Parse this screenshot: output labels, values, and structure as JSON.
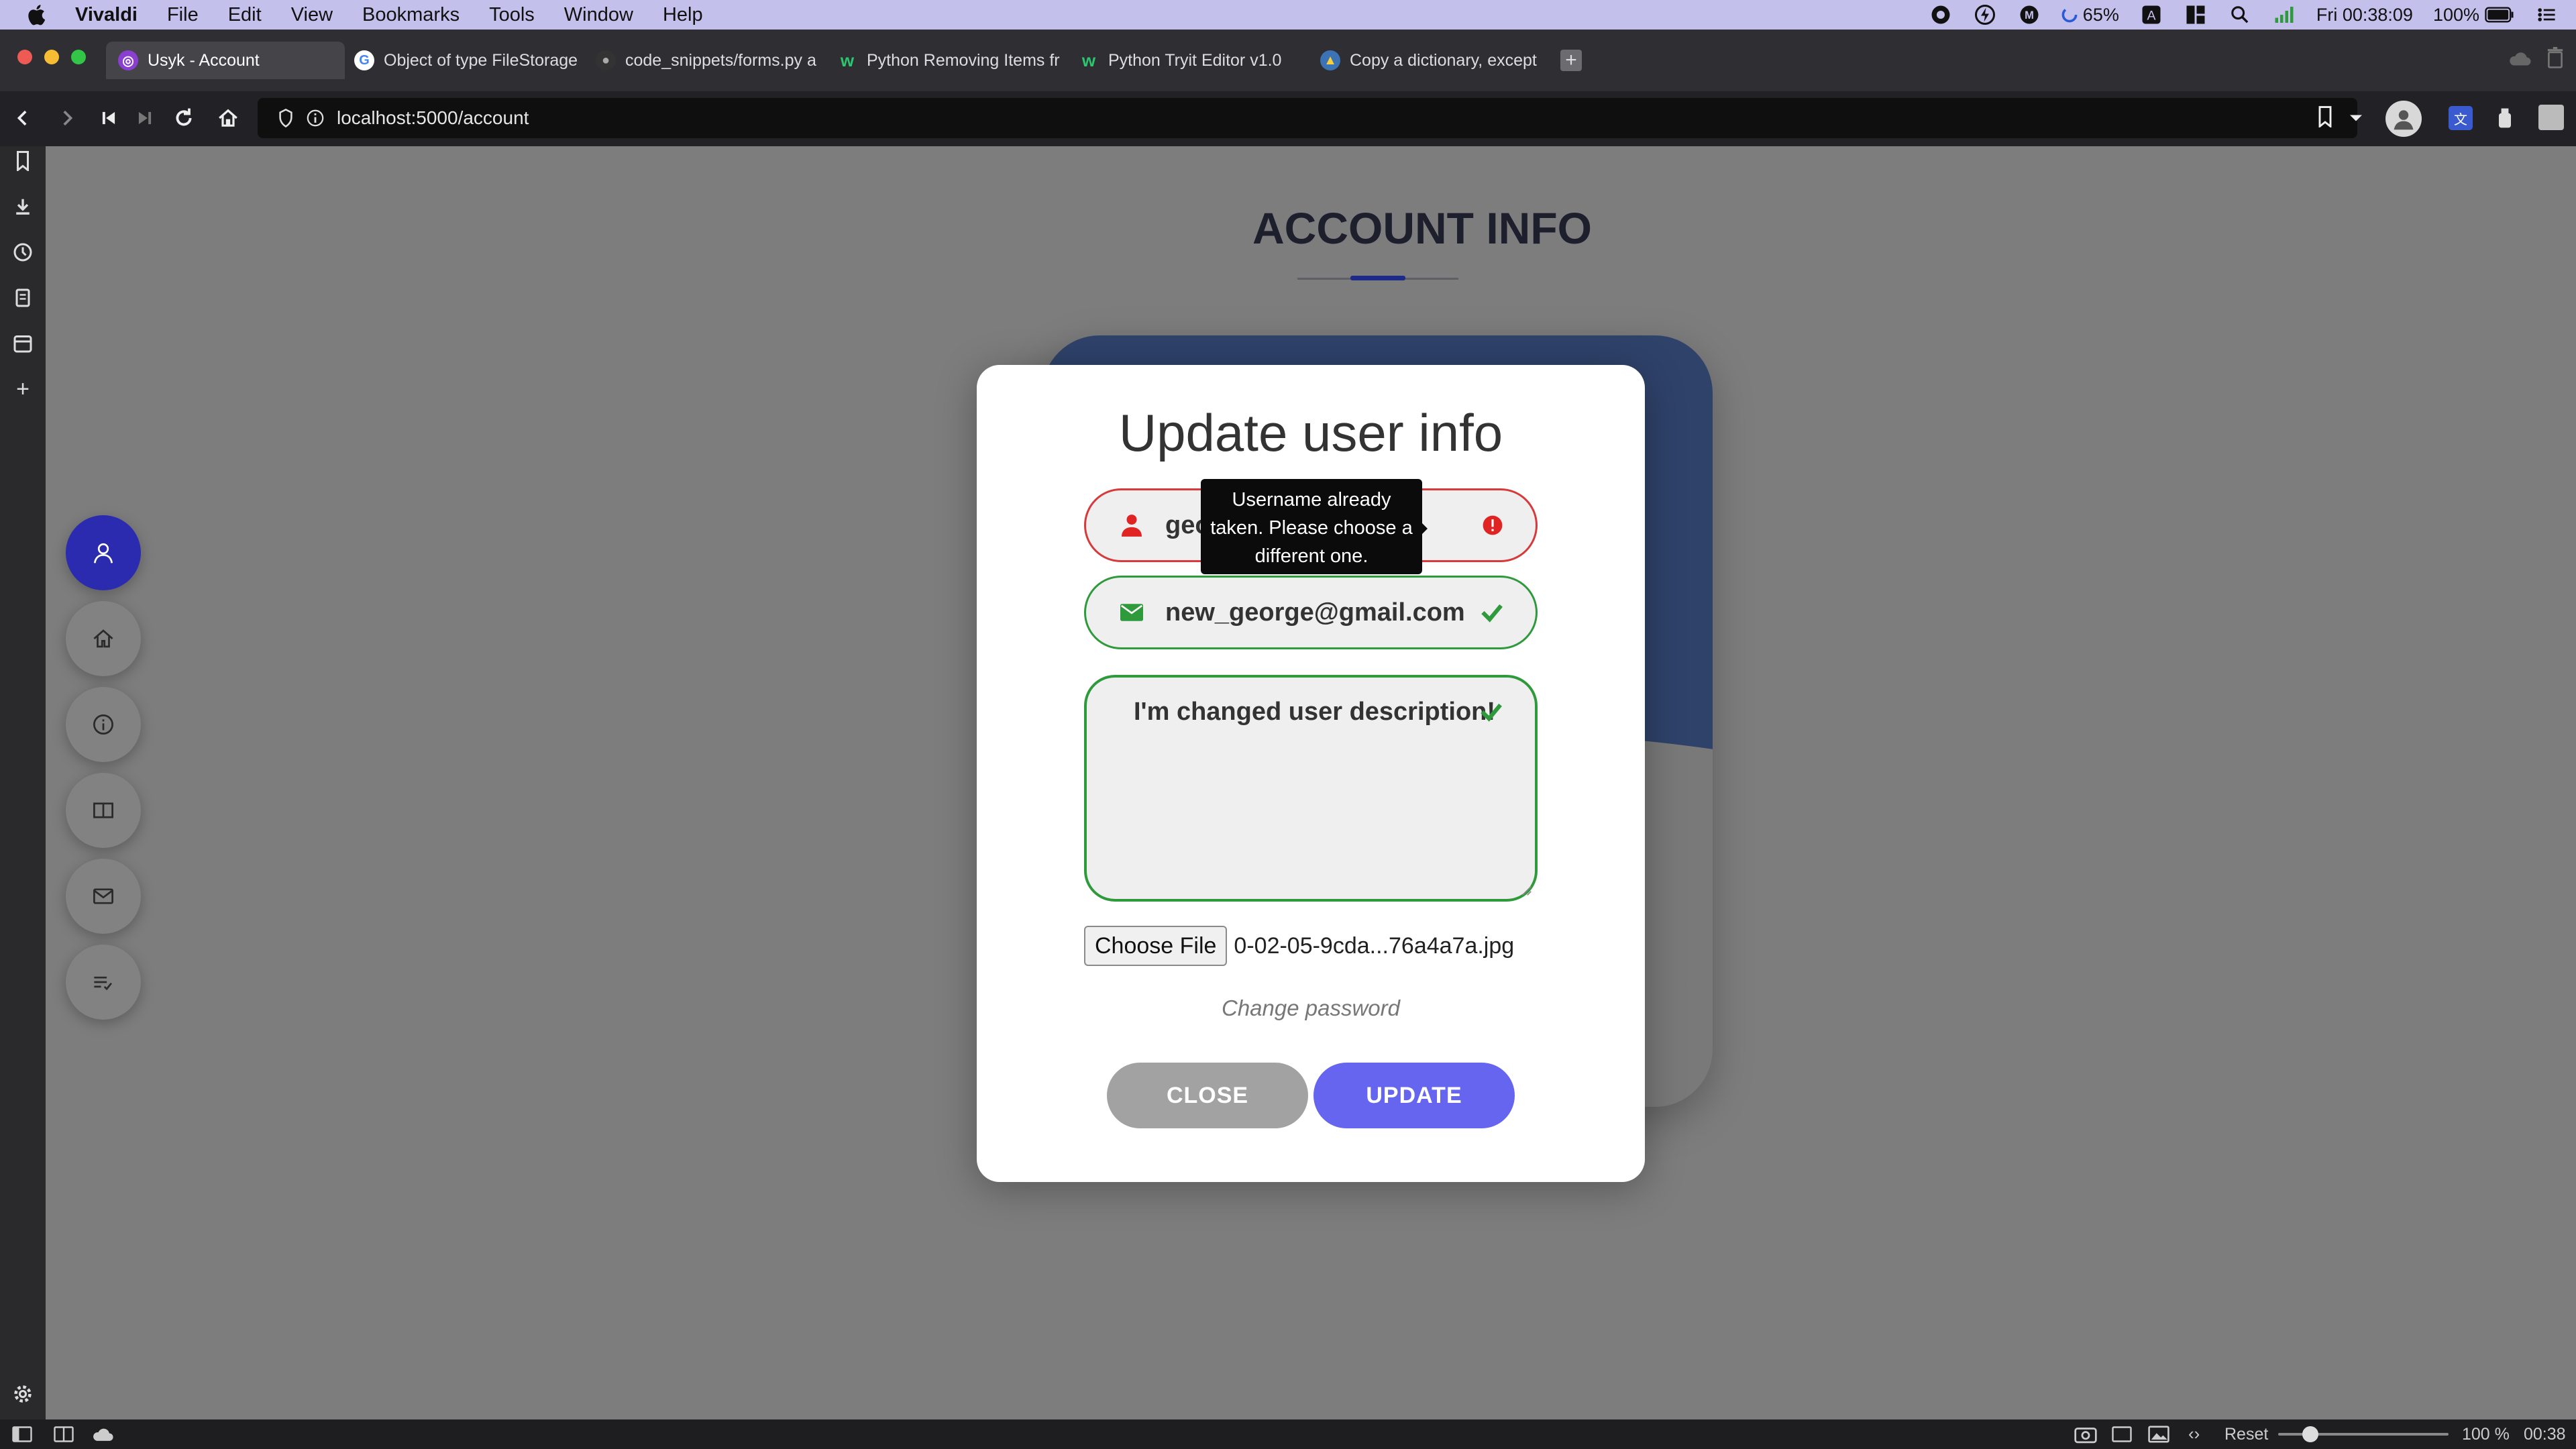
{
  "menubar": {
    "app_name": "Vivaldi",
    "items": [
      "File",
      "Edit",
      "View",
      "Bookmarks",
      "Tools",
      "Window",
      "Help"
    ],
    "battery_small": "65%",
    "datetime": "Fri 00:38:09",
    "battery": "100%"
  },
  "tabs": [
    {
      "label": "Usyk - Account",
      "active": true
    },
    {
      "label": "Object of type FileStorage"
    },
    {
      "label": "code_snippets/forms.py a"
    },
    {
      "label": "Python Removing Items fr"
    },
    {
      "label": "Python Tryit Editor v1.0"
    },
    {
      "label": "Copy a dictionary, except"
    }
  ],
  "address": {
    "url": "localhost:5000/account"
  },
  "page": {
    "title": "ACCOUNT INFO"
  },
  "modal": {
    "title": "Update user info",
    "username_value": "geor",
    "username_error": "Username already taken. Please choose a different one.",
    "email_value": "new_george@gmail.com",
    "description_value": "I'm changed user description!",
    "file_button": "Choose File",
    "file_name": "0-02-05-9cda...76a4a7a.jpg",
    "change_password": "Change password",
    "close_button": "CLOSE",
    "update_button": "UPDATE"
  },
  "statusbar": {
    "reset": "Reset",
    "zoom": "100 %",
    "time": "00:38"
  },
  "colors": {
    "modal_accent": "#6565f0",
    "error": "#d63a3a",
    "valid": "#2f9a3c",
    "nav_active": "#2b2bb0"
  }
}
